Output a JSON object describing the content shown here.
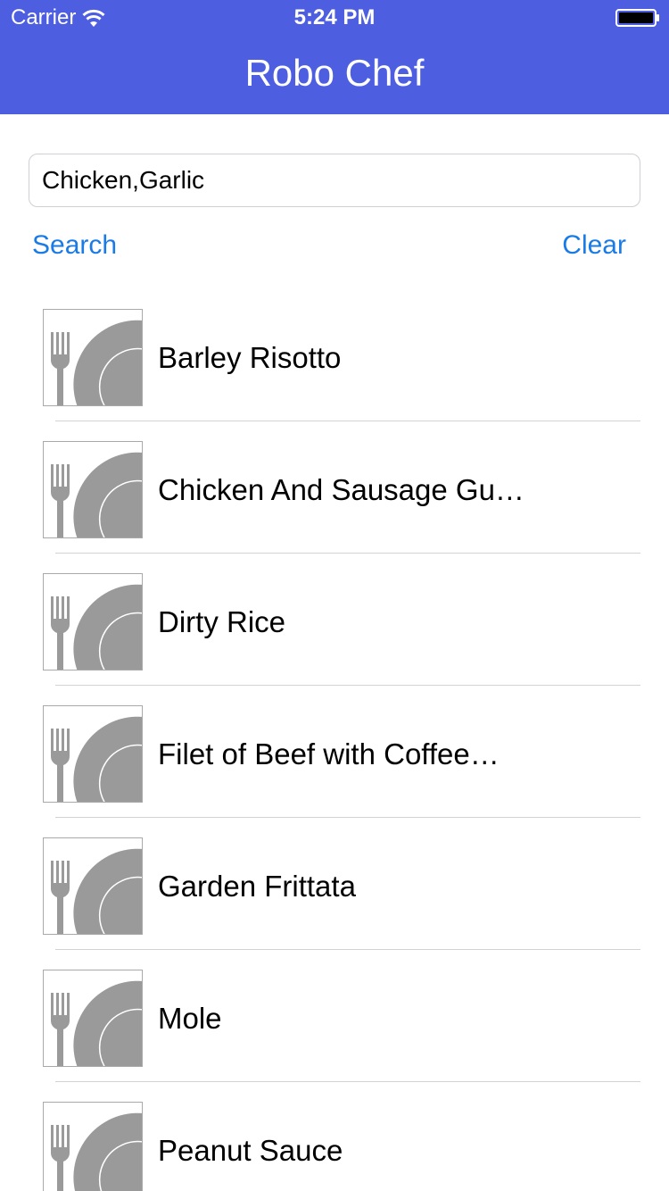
{
  "status_bar": {
    "carrier": "Carrier",
    "time": "5:24 PM",
    "icons": [
      "wifi-icon",
      "battery-icon"
    ]
  },
  "nav": {
    "title": "Robo Chef",
    "background_color": "#4d5ee0"
  },
  "search": {
    "value": "Chicken,Garlic",
    "placeholder": ""
  },
  "actions": {
    "search_label": "Search",
    "clear_label": "Clear",
    "accent_color": "#1a7be6"
  },
  "recipes": [
    {
      "name": "Barley Risotto",
      "icon": "fork-plate-icon"
    },
    {
      "name": "Chicken And Sausage Gu…",
      "icon": "fork-plate-icon"
    },
    {
      "name": "Dirty Rice",
      "icon": "fork-plate-icon"
    },
    {
      "name": "Filet of Beef with Coffee…",
      "icon": "fork-plate-icon"
    },
    {
      "name": "Garden Frittata",
      "icon": "fork-plate-icon"
    },
    {
      "name": "Mole",
      "icon": "fork-plate-icon"
    },
    {
      "name": "Peanut Sauce",
      "icon": "fork-plate-icon"
    }
  ]
}
